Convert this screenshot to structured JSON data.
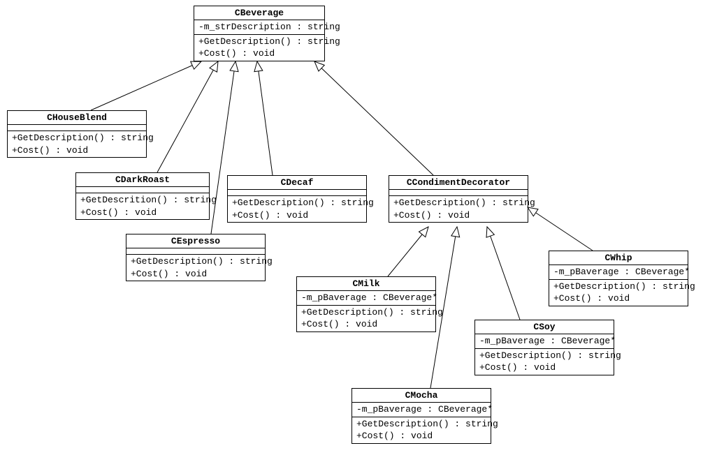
{
  "diagram": {
    "type": "UML class diagram",
    "description": "Decorator design pattern for beverages",
    "relationships": [
      {
        "from": "CHouseBlend",
        "to": "CBeverage",
        "type": "inheritance"
      },
      {
        "from": "CDarkRoast",
        "to": "CBeverage",
        "type": "inheritance"
      },
      {
        "from": "CEspresso",
        "to": "CBeverage",
        "type": "inheritance"
      },
      {
        "from": "CDecaf",
        "to": "CBeverage",
        "type": "inheritance"
      },
      {
        "from": "CCondimentDecorator",
        "to": "CBeverage",
        "type": "inheritance"
      },
      {
        "from": "CMilk",
        "to": "CCondimentDecorator",
        "type": "inheritance"
      },
      {
        "from": "CMocha",
        "to": "CCondimentDecorator",
        "type": "inheritance"
      },
      {
        "from": "CSoy",
        "to": "CCondimentDecorator",
        "type": "inheritance"
      },
      {
        "from": "CWhip",
        "to": "CCondimentDecorator",
        "type": "inheritance"
      }
    ]
  },
  "classes": {
    "cbeverage": {
      "name": "CBeverage",
      "attr1": "-m_strDescription : string",
      "op1": "+GetDescription() : string",
      "op2": "+Cost() : void"
    },
    "chouseblend": {
      "name": "CHouseBlend",
      "op1": "+GetDescription() : string",
      "op2": "+Cost() : void"
    },
    "cdarkroast": {
      "name": "CDarkRoast",
      "op1": "+GetDescrition() : string",
      "op2": "+Cost() : void"
    },
    "cespresso": {
      "name": "CEspresso",
      "op1": "+GetDescription() : string",
      "op2": "+Cost() : void"
    },
    "cdecaf": {
      "name": "CDecaf",
      "op1": "+GetDescription() : string",
      "op2": "+Cost() : void"
    },
    "ccondimentdecorator": {
      "name": "CCondimentDecorator",
      "op1": "+GetDescription() : string",
      "op2": "+Cost() : void"
    },
    "cmilk": {
      "name": "CMilk",
      "attr1": "-m_pBaverage : CBeverage*",
      "op1": "+GetDescription() : string",
      "op2": "+Cost() : void"
    },
    "cmocha": {
      "name": "CMocha",
      "attr1": "-m_pBaverage : CBeverage*",
      "op1": "+GetDescription() : string",
      "op2": "+Cost() : void"
    },
    "csoy": {
      "name": "CSoy",
      "attr1": "-m_pBaverage : CBeverage*",
      "op1": "+GetDescription() : string",
      "op2": "+Cost() : void"
    },
    "cwhip": {
      "name": "CWhip",
      "attr1": "-m_pBaverage : CBeverage*",
      "op1": "+GetDescription() : string",
      "op2": "+Cost() : void"
    }
  }
}
